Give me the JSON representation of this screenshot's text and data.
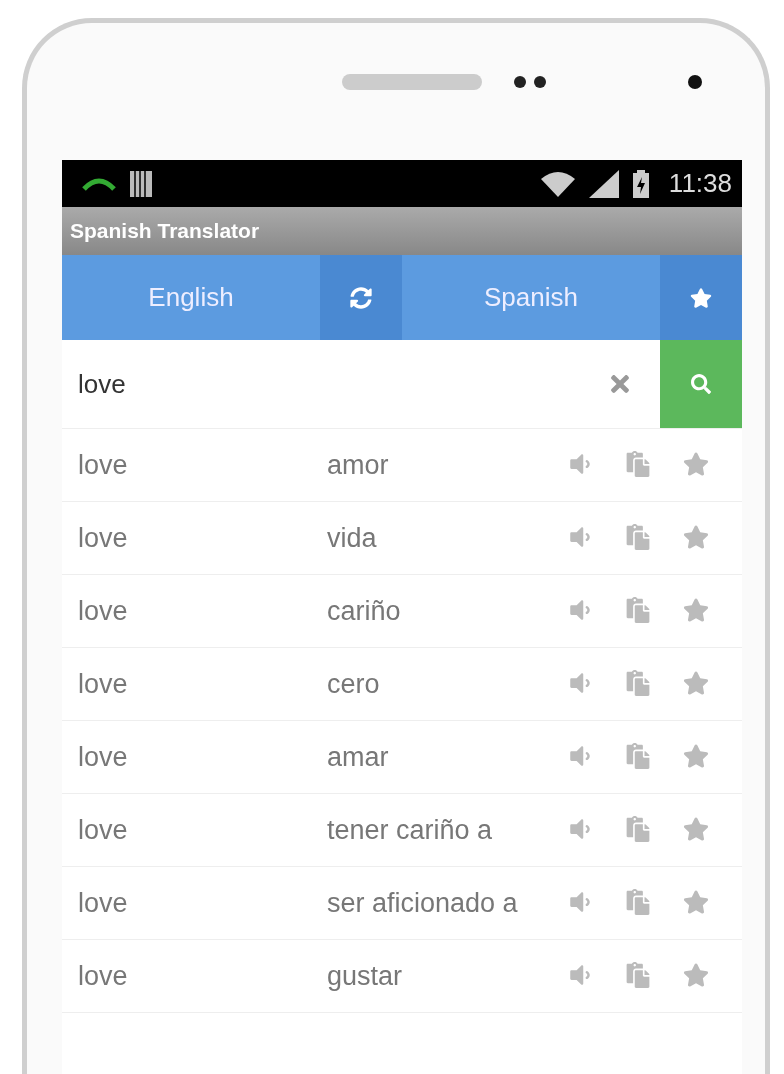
{
  "status_bar": {
    "time": "11:38"
  },
  "app_title": "Spanish Translator",
  "language_bar": {
    "source": "English",
    "target": "Spanish"
  },
  "search": {
    "value": "love"
  },
  "results": [
    {
      "source": "love",
      "translation": "amor"
    },
    {
      "source": "love",
      "translation": "vida"
    },
    {
      "source": "love",
      "translation": "cariño"
    },
    {
      "source": "love",
      "translation": "cero"
    },
    {
      "source": "love",
      "translation": "amar"
    },
    {
      "source": "love",
      "translation": "tener cariño a"
    },
    {
      "source": "love",
      "translation": "ser aficionado a"
    },
    {
      "source": "love",
      "translation": "gustar"
    }
  ]
}
